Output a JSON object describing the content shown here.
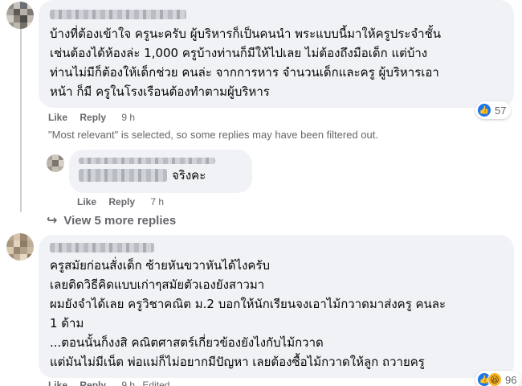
{
  "comment1": {
    "author": "",
    "lines": [
      "บ้างที่ต้องเข้าใจ ครูนะครับ ผู้บริหารก็เป็นคนนำ พระแบบนี้มาให้ครูประจำชั้น",
      "เช่นต้องได้ห้องล่ะ 1,000 ครูบ้างท่านก็มีให้ไปเลย ไม่ต้องถึงมือเด็ก แต่บ้าง",
      "ท่านไม่มีก็ต้องให้เด็กช่วย คนล่ะ จากการหาร จำนวนเด็กและครู ผู้บริหารเอา",
      "หน้า ก็มี ครูในโรงเรือนต้องทำตามผู้บริหาร"
    ],
    "like_label": "Like",
    "reply_label": "Reply",
    "time": "9 h",
    "reaction_icon": "like-icon",
    "reaction_count": "57"
  },
  "filter_note": "\"Most relevant\" is selected, so some replies may have been filtered out.",
  "reply1": {
    "text": "จริงคะ",
    "like_label": "Like",
    "reply_label": "Reply",
    "time": "7 h"
  },
  "view_more": {
    "label": "View 5 more replies",
    "icon": "reply-arrow-icon"
  },
  "comment2": {
    "lines": [
      "ครูสมัยก่อนสั่งเด็ก ซ้ายหันขวาหันได้ไงครับ",
      "เลยติดวิธีคิดแบบเก่าๆสมัยตัวเองยังสาวมา",
      "ผมยังจำได้เลย ครูวิชาคณิต ม.2 บอกให้นักเรียนจงเอาไม้กวาดมาส่งครู คนละ",
      "1 ด้าม",
      "...ตอนนั้นก็งงสิ คณิตศาสตร์เกี่ยวข้องยังไงกับไม้กวาด",
      "แต่มันไม่มีเน็ต พ่อแม่ก็ไม่อยากมีปัญหา เลยต้องซื้อไม้กวาดให้ลูก ถวายครู"
    ],
    "like_label": "Like",
    "reply_label": "Reply",
    "time": "9 h",
    "edited_label": "Edited",
    "reaction_icons": [
      "like-icon",
      "haha-icon"
    ],
    "reaction_count": "96"
  },
  "colors": {
    "bubble": "#f0f2f5",
    "meta_text": "#65676b",
    "like_blue": "#1877f2"
  }
}
